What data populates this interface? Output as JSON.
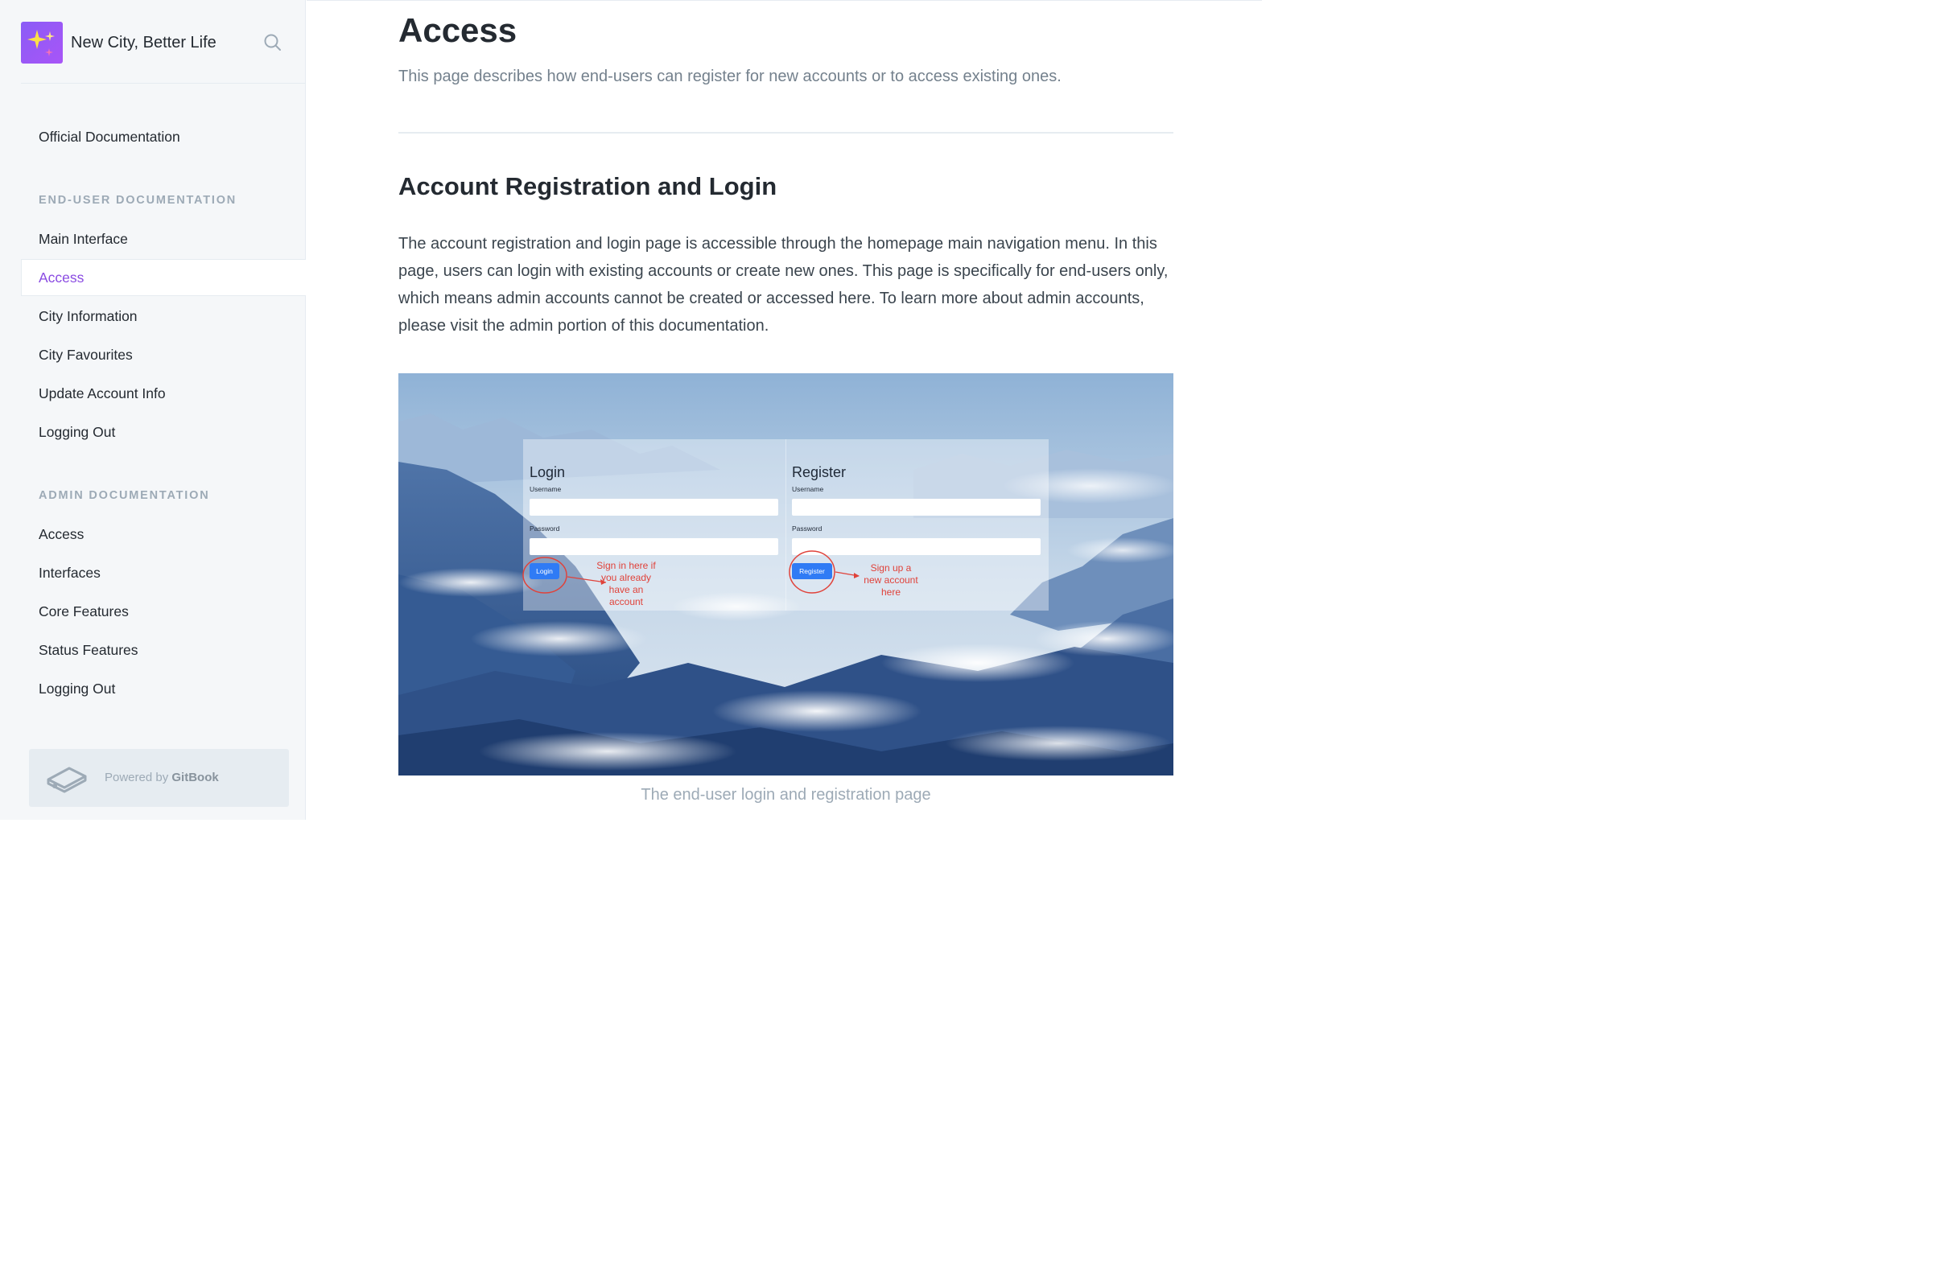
{
  "sidebar": {
    "brand_title": "New City, Better Life",
    "official_doc": "Official Documentation",
    "section_end_user": "END-USER DOCUMENTATION",
    "end_user_items": [
      "Main Interface",
      "Access",
      "City Information",
      "City Favourites",
      "Update Account Info",
      "Logging Out"
    ],
    "section_admin": "ADMIN DOCUMENTATION",
    "admin_items": [
      "Access",
      "Interfaces",
      "Core Features",
      "Status Features",
      "Logging Out"
    ],
    "powered_prefix": "Powered by ",
    "powered_brand": "GitBook",
    "active_item": "Access"
  },
  "main": {
    "title": "Access",
    "description": "This page describes how end-users can register for new accounts or to access existing ones.",
    "section_heading": "Account Registration and Login",
    "paragraph": "The account registration and login page is accessible through the homepage main navigation menu. In this page, users can login with existing accounts or create new ones. This page is specifically for end-users only, which means admin accounts cannot be created or accessed here. To learn more about admin accounts, please visit the admin portion of this documentation.",
    "figure_caption": "The end-user login and registration page"
  },
  "screenshot": {
    "login_title": "Login",
    "register_title": "Register",
    "username_label": "Username",
    "password_label": "Password",
    "login_button": "Login",
    "register_button": "Register",
    "login_note": [
      "Sign in here if",
      "you already",
      "have an",
      "account"
    ],
    "register_note": [
      "Sign up a",
      "new account",
      "here"
    ]
  },
  "colors": {
    "accent": "#8a4be2",
    "annotation": "#e0423a",
    "button_blue": "#2f7bf5"
  },
  "icons": {
    "logo": "sparkles-icon",
    "search": "search-icon",
    "gitbook": "gitbook-icon"
  }
}
